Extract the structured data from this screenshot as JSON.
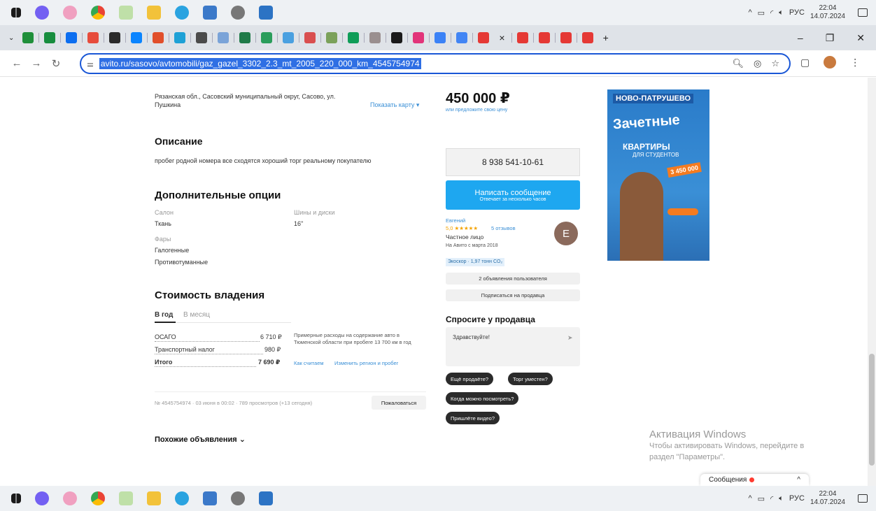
{
  "taskbar_top": {
    "icons": [
      "windows-start-icon",
      "viber-icon",
      "snipping-icon",
      "chrome-icon",
      "excel-icon",
      "explorer-icon",
      "telegram-icon",
      "notepad-icon",
      "settings-icon",
      "photos-icon"
    ]
  },
  "tray": {
    "lang": "РУС",
    "time": "22:04",
    "date": "14.07.2024"
  },
  "tabs": {
    "colors": [
      "#1f8f3a",
      "#178d3e",
      "#0c6ef0",
      "#e74c3c",
      "#2a2a2a",
      "#0a84ff",
      "#e14f2b",
      "#1ea1d6",
      "#4b4b4b",
      "#7aa3d8",
      "#1f7a49",
      "#2a9d5b",
      "#4aa0e0",
      "#d94f4f",
      "#7ba15a",
      "#0f9d58",
      "#9a8f8f",
      "#1a1a1a",
      "#e2347a",
      "#3b82f6",
      "#4285f4",
      "#e53935",
      "#e53935",
      "#e53935",
      "#e53935",
      "#e53935"
    ],
    "close": "×",
    "new": "+"
  },
  "address": {
    "url": "avito.ru/sasovo/avtomobili/gaz_gazel_3302_2.3_mt_2005_220_000_km_4545754974"
  },
  "location": {
    "line1": "Рязанская обл., Сасовский муниципальный округ, Сасово, ул.",
    "line2": "Пушкина",
    "map_link": "Показать карту ▾"
  },
  "description": {
    "title": "Описание",
    "text": "пробег родной номера все сходятся хороший торг реальному покупателю"
  },
  "options": {
    "title": "Дополнительные опции",
    "salon_label": "Салон",
    "salon_value": "Ткань",
    "wheels_label": "Шины и диски",
    "wheels_value": "16\"",
    "lights_label": "Фары",
    "lights_1": "Галогенные",
    "lights_2": "Противотуманные"
  },
  "ownership": {
    "title": "Стоимость владения",
    "tab_year": "В год",
    "tab_month": "В месяц",
    "osago_label": "ОСАГО",
    "osago_value": "6 710 ₽",
    "tax_label": "Транспортный налог",
    "tax_value": "980 ₽",
    "total_label": "Итого",
    "total_value": "7 690 ₽",
    "note": "Примерные расходы на содержание авто в Тюменской области при пробеге 13 700 км в год",
    "how_link": "Как считаем",
    "change_link": "Изменить регион и пробег"
  },
  "meta": {
    "text": "№ 4545754974 · 03 июня в 00:02 · 789 просмотров (+13 сегодня)",
    "complain": "Пожаловаться"
  },
  "similar": {
    "title": "Похожие объявления ⌄"
  },
  "price": {
    "value": "450 000 ₽",
    "sub": "или предложите свою цену"
  },
  "phone": {
    "number": "8 938 541-10-61"
  },
  "write": {
    "label": "Написать сообщение",
    "sub": "Отвечает за несколько часов"
  },
  "seller": {
    "name": "Евгений",
    "rating": "5,0 ★★★★★",
    "reviews": "5 отзывов",
    "type": "Частное лицо",
    "since": "На Авито с марта 2018",
    "badge": "Экоскор · 1,97 тонн CO₂",
    "avatar": "E",
    "ads_btn": "2 объявления пользователя",
    "subscribe_btn": "Подписаться на продавца"
  },
  "ask": {
    "title": "Спросите у продавца",
    "placeholder": "Здравствуйте!",
    "send": "➤",
    "q1": "Ещё продаёте?",
    "q2": "Торг уместен?",
    "q3": "Когда можно посмотреть?",
    "q4": "Пришлёте видео?"
  },
  "ad": {
    "logo": "НОВО-ПАТРУШЕВО",
    "big": "Зачетные",
    "mid": "КВАРТИРЫ",
    "mid2": "ДЛЯ СТУДЕНТОВ",
    "price": "3 450 000"
  },
  "watermark": {
    "line1": "Активация Windows",
    "line2": "Чтобы активировать Windows, перейдите в",
    "line3": "раздел \"Параметры\"."
  },
  "messages": {
    "label": "Сообщения",
    "chev": "^"
  }
}
